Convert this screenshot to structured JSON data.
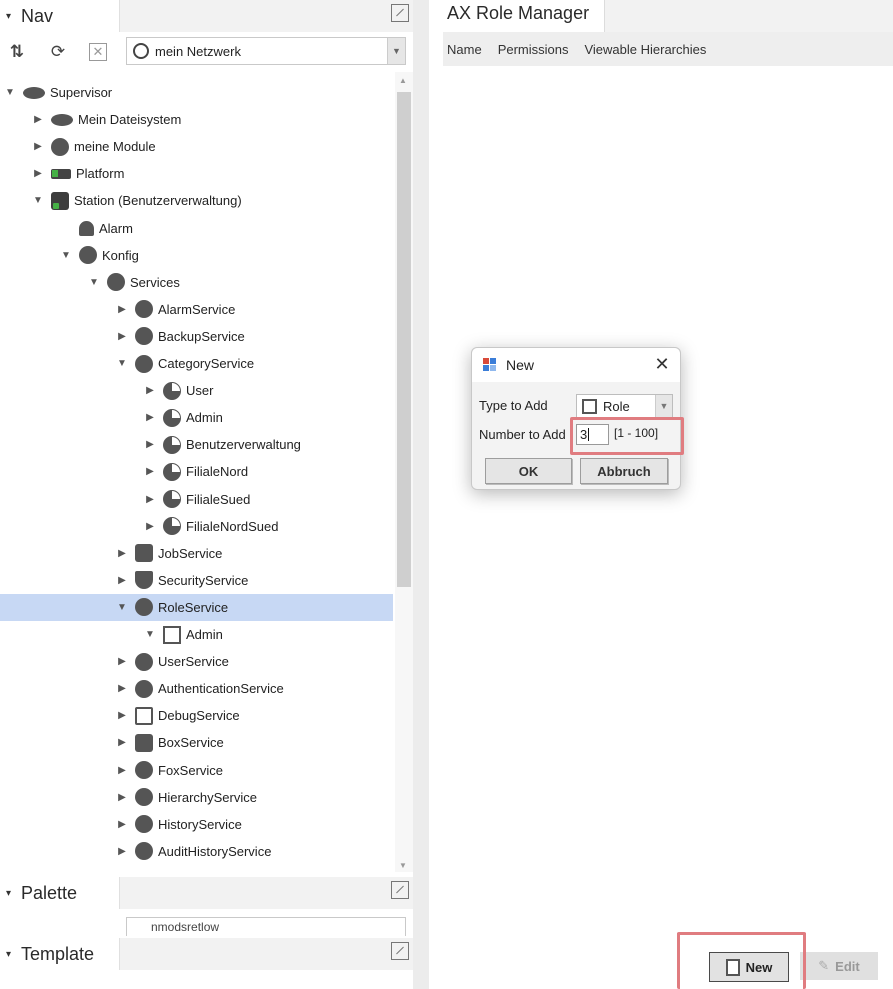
{
  "nav": {
    "title": "Nav",
    "network_select": "mein Netzwerk",
    "tree": [
      {
        "label": "Supervisor",
        "depth": 0,
        "twisty": "open",
        "icon": "flat",
        "name": "supervisor"
      },
      {
        "label": "Mein Dateisystem",
        "depth": 1,
        "twisty": "closed",
        "icon": "flat",
        "name": "mein-dateisystem"
      },
      {
        "label": "meine Module",
        "depth": 1,
        "twisty": "closed",
        "icon": "round",
        "name": "meine-module"
      },
      {
        "label": "Platform",
        "depth": 1,
        "twisty": "closed",
        "icon": "platform",
        "name": "platform"
      },
      {
        "label": "Station (Benutzerverwaltung)",
        "depth": 1,
        "twisty": "open",
        "icon": "station",
        "name": "station"
      },
      {
        "label": "Alarm",
        "depth": 2,
        "twisty": "none",
        "icon": "bell",
        "name": "alarm"
      },
      {
        "label": "Konfig",
        "depth": 2,
        "twisty": "open",
        "icon": "round",
        "name": "konfig"
      },
      {
        "label": "Services",
        "depth": 3,
        "twisty": "open",
        "icon": "round",
        "name": "services"
      },
      {
        "label": "AlarmService",
        "depth": 4,
        "twisty": "closed",
        "icon": "round",
        "name": "alarmservice"
      },
      {
        "label": "BackupService",
        "depth": 4,
        "twisty": "closed",
        "icon": "round",
        "name": "backupservice"
      },
      {
        "label": "CategoryService",
        "depth": 4,
        "twisty": "open",
        "icon": "round",
        "name": "categoryservice"
      },
      {
        "label": "User",
        "depth": 5,
        "twisty": "closed",
        "icon": "pie",
        "name": "category-user"
      },
      {
        "label": "Admin",
        "depth": 5,
        "twisty": "closed",
        "icon": "pie",
        "name": "category-admin"
      },
      {
        "label": "Benutzerverwaltung",
        "depth": 5,
        "twisty": "closed",
        "icon": "pie",
        "name": "category-benutzerverwaltung"
      },
      {
        "label": "FilialeNord",
        "depth": 5,
        "twisty": "closed",
        "icon": "pie",
        "name": "category-filialenord"
      },
      {
        "label": "FilialeSued",
        "depth": 5,
        "twisty": "closed",
        "icon": "pie",
        "name": "category-filialesued"
      },
      {
        "label": "FilialeNordSued",
        "depth": 5,
        "twisty": "closed",
        "icon": "pie",
        "name": "category-filialenordsued"
      },
      {
        "label": "JobService",
        "depth": 4,
        "twisty": "closed",
        "icon": "square",
        "name": "jobservice"
      },
      {
        "label": "SecurityService",
        "depth": 4,
        "twisty": "closed",
        "icon": "shield",
        "name": "securityservice"
      },
      {
        "label": "RoleService",
        "depth": 4,
        "twisty": "open",
        "icon": "round",
        "name": "roleservice",
        "selected": true
      },
      {
        "label": "Admin",
        "depth": 5,
        "twisty": "open",
        "icon": "cube",
        "name": "role-admin"
      },
      {
        "label": "UserService",
        "depth": 4,
        "twisty": "closed",
        "icon": "round",
        "name": "userservice"
      },
      {
        "label": "AuthenticationService",
        "depth": 4,
        "twisty": "closed",
        "icon": "round",
        "name": "authenticationservice"
      },
      {
        "label": "DebugService",
        "depth": 4,
        "twisty": "closed",
        "icon": "debug",
        "name": "debugservice"
      },
      {
        "label": "BoxService",
        "depth": 4,
        "twisty": "closed",
        "icon": "square",
        "name": "boxservice"
      },
      {
        "label": "FoxService",
        "depth": 4,
        "twisty": "closed",
        "icon": "round",
        "name": "foxservice"
      },
      {
        "label": "HierarchyService",
        "depth": 4,
        "twisty": "closed",
        "icon": "round",
        "name": "hierarchyservice"
      },
      {
        "label": "HistoryService",
        "depth": 4,
        "twisty": "closed",
        "icon": "round",
        "name": "historyservice"
      },
      {
        "label": "AuditHistoryService",
        "depth": 4,
        "twisty": "closed",
        "icon": "round",
        "name": "audithistoryservice"
      }
    ]
  },
  "palette": {
    "title": "Palette",
    "select_value": "nmodsretlow"
  },
  "template": {
    "title": "Template"
  },
  "main": {
    "tab_title": "AX Role Manager",
    "columns": [
      "Name",
      "Permissions",
      "Viewable Hierarchies"
    ],
    "new_button": "New",
    "edit_button": "Edit"
  },
  "dialog": {
    "title": "New",
    "type_label": "Type to Add",
    "type_value": "Role",
    "number_label": "Number to Add",
    "number_value": "3",
    "number_range": "[1 - 100]",
    "ok_label": "OK",
    "cancel_label": "Abbruch"
  },
  "colors": {
    "selection": "#c7d8f4",
    "highlight": "#e07c80",
    "header_bg": "#eeeeee"
  }
}
